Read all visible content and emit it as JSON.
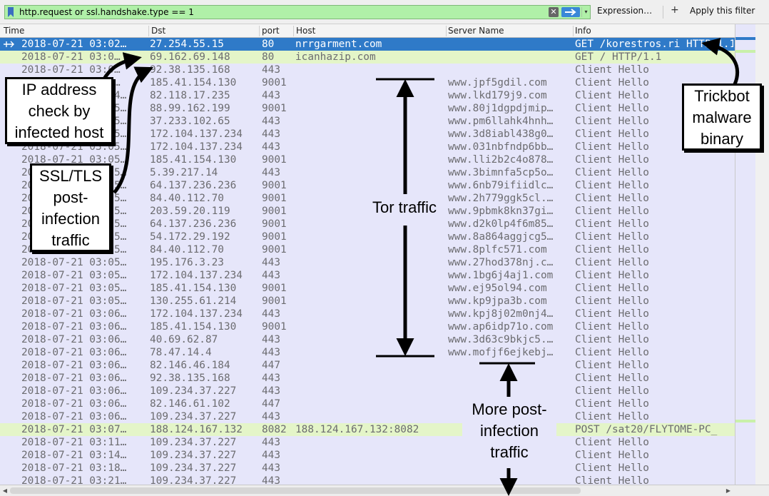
{
  "toolbar": {
    "filter_value": "http.request or ssl.handshake.type == 1",
    "clear_glyph": "✕",
    "dropdown_glyph": "▾",
    "expression_label": "Expression…",
    "add_glyph": "+",
    "apply_label": "Apply this filter",
    "filter_color": "#b0f0a8"
  },
  "columns": [
    "Time",
    "Dst",
    "port",
    "Host",
    "Server Name",
    "Info"
  ],
  "colors": {
    "selected_row": "#2f7ac8",
    "http_row": "#e4f5c8",
    "tls_row": "#e6e6fa"
  },
  "packets": [
    {
      "time": "2018-07-21 03:02…",
      "dst": "27.254.55.15",
      "port": "80",
      "host": "nrrgarment.com",
      "sni": "",
      "info": "GET /korestros.ri HTTP/1.1",
      "kind": "selected"
    },
    {
      "time": "2018-07-21 03:0…",
      "dst": "69.162.69.148",
      "port": "80",
      "host": "icanhazip.com",
      "sni": "",
      "info": "GET / HTTP/1.1",
      "kind": "http"
    },
    {
      "time": "2018-07-21 03:0…",
      "dst": "92.38.135.168",
      "port": "443",
      "host": "",
      "sni": "",
      "info": "Client Hello",
      "kind": "tls"
    },
    {
      "time": "2018-07-21 03:0…",
      "dst": "185.41.154.130",
      "port": "9001",
      "host": "",
      "sni": "www.jpf5gdil.com",
      "info": "Client Hello",
      "kind": "tls"
    },
    {
      "time": "2018-07-21 03:04…",
      "dst": "82.118.17.235",
      "port": "443",
      "host": "",
      "sni": "www.lkd179j9.com",
      "info": "Client Hello",
      "kind": "tls"
    },
    {
      "time": "2018-07-21 03:05…",
      "dst": "88.99.162.199",
      "port": "9001",
      "host": "",
      "sni": "www.80j1dgpdjmip…",
      "info": "Client Hello",
      "kind": "tls"
    },
    {
      "time": "2018-07-21 03:05…",
      "dst": "37.233.102.65",
      "port": "443",
      "host": "",
      "sni": "www.pm6llahk4hnh…",
      "info": "Client Hello",
      "kind": "tls"
    },
    {
      "time": "2018-07-21 03:05…",
      "dst": "172.104.137.234",
      "port": "443",
      "host": "",
      "sni": "www.3d8iabl438g0…",
      "info": "Client Hello",
      "kind": "tls"
    },
    {
      "time": "2018-07-21 03:05…",
      "dst": "172.104.137.234",
      "port": "443",
      "host": "",
      "sni": "www.031nbfndp6bb…",
      "info": "Client Hello",
      "kind": "tls"
    },
    {
      "time": "2018-07-21 03:05…",
      "dst": "185.41.154.130",
      "port": "9001",
      "host": "",
      "sni": "www.lli2b2c4o878…",
      "info": "Client Hello",
      "kind": "tls"
    },
    {
      "time": "2018-07-21 03:05…",
      "dst": "5.39.217.14",
      "port": "443",
      "host": "",
      "sni": "www.3bimnfa5cp5o…",
      "info": "Client Hello",
      "kind": "tls"
    },
    {
      "time": "2018-07-21 03:05…",
      "dst": "64.137.236.236",
      "port": "9001",
      "host": "",
      "sni": "www.6nb79ifiidlc…",
      "info": "Client Hello",
      "kind": "tls"
    },
    {
      "time": "2018-07-21 03:05…",
      "dst": "84.40.112.70",
      "port": "9001",
      "host": "",
      "sni": "www.2h779ggk5cl.…",
      "info": "Client Hello",
      "kind": "tls"
    },
    {
      "time": "2018-07-21 03:05…",
      "dst": "203.59.20.119",
      "port": "9001",
      "host": "",
      "sni": "www.9pbmk8kn37gi…",
      "info": "Client Hello",
      "kind": "tls"
    },
    {
      "time": "2018-07-21 03:05…",
      "dst": "64.137.236.236",
      "port": "9001",
      "host": "",
      "sni": "www.d2k0lp4f6m85…",
      "info": "Client Hello",
      "kind": "tls"
    },
    {
      "time": "2018-07-21 03:05…",
      "dst": "54.172.29.192",
      "port": "9001",
      "host": "",
      "sni": "www.8a864aggjcg5…",
      "info": "Client Hello",
      "kind": "tls"
    },
    {
      "time": "2018-07-21 03:05…",
      "dst": "84.40.112.70",
      "port": "9001",
      "host": "",
      "sni": "www.8plfc571.com",
      "info": "Client Hello",
      "kind": "tls"
    },
    {
      "time": "2018-07-21 03:05…",
      "dst": "195.176.3.23",
      "port": "443",
      "host": "",
      "sni": "www.27hod378nj.c…",
      "info": "Client Hello",
      "kind": "tls"
    },
    {
      "time": "2018-07-21 03:05…",
      "dst": "172.104.137.234",
      "port": "443",
      "host": "",
      "sni": "www.1bg6j4aj1.com",
      "info": "Client Hello",
      "kind": "tls"
    },
    {
      "time": "2018-07-21 03:05…",
      "dst": "185.41.154.130",
      "port": "9001",
      "host": "",
      "sni": "www.ej95ol94.com",
      "info": "Client Hello",
      "kind": "tls"
    },
    {
      "time": "2018-07-21 03:05…",
      "dst": "130.255.61.214",
      "port": "9001",
      "host": "",
      "sni": "www.kp9jpa3b.com",
      "info": "Client Hello",
      "kind": "tls"
    },
    {
      "time": "2018-07-21 03:06…",
      "dst": "172.104.137.234",
      "port": "443",
      "host": "",
      "sni": "www.kpj8j02m0nj4…",
      "info": "Client Hello",
      "kind": "tls"
    },
    {
      "time": "2018-07-21 03:06…",
      "dst": "185.41.154.130",
      "port": "9001",
      "host": "",
      "sni": "www.ap6idp71o.com",
      "info": "Client Hello",
      "kind": "tls"
    },
    {
      "time": "2018-07-21 03:06…",
      "dst": "40.69.62.87",
      "port": "443",
      "host": "",
      "sni": "www.3d63c9bkjc5.…",
      "info": "Client Hello",
      "kind": "tls"
    },
    {
      "time": "2018-07-21 03:06…",
      "dst": "78.47.14.4",
      "port": "443",
      "host": "",
      "sni": "www.mofjf6ejkebj…",
      "info": "Client Hello",
      "kind": "tls"
    },
    {
      "time": "2018-07-21 03:06…",
      "dst": "82.146.46.184",
      "port": "447",
      "host": "",
      "sni": "",
      "info": "Client Hello",
      "kind": "tls"
    },
    {
      "time": "2018-07-21 03:06…",
      "dst": "92.38.135.168",
      "port": "443",
      "host": "",
      "sni": "",
      "info": "Client Hello",
      "kind": "tls"
    },
    {
      "time": "2018-07-21 03:06…",
      "dst": "109.234.37.227",
      "port": "443",
      "host": "",
      "sni": "",
      "info": "Client Hello",
      "kind": "tls"
    },
    {
      "time": "2018-07-21 03:06…",
      "dst": "82.146.61.102",
      "port": "447",
      "host": "",
      "sni": "",
      "info": "Client Hello",
      "kind": "tls"
    },
    {
      "time": "2018-07-21 03:06…",
      "dst": "109.234.37.227",
      "port": "443",
      "host": "",
      "sni": "",
      "info": "Client Hello",
      "kind": "tls"
    },
    {
      "time": "2018-07-21 03:07…",
      "dst": "188.124.167.132",
      "port": "8082",
      "host": "188.124.167.132:8082",
      "sni": "",
      "info": "POST /sat20/FLYTOME-PC_",
      "kind": "http"
    },
    {
      "time": "2018-07-21 03:11…",
      "dst": "109.234.37.227",
      "port": "443",
      "host": "",
      "sni": "",
      "info": "Client Hello",
      "kind": "tls"
    },
    {
      "time": "2018-07-21 03:14…",
      "dst": "109.234.37.227",
      "port": "443",
      "host": "",
      "sni": "",
      "info": "Client Hello",
      "kind": "tls"
    },
    {
      "time": "2018-07-21 03:18…",
      "dst": "109.234.37.227",
      "port": "443",
      "host": "",
      "sni": "",
      "info": "Client Hello",
      "kind": "tls"
    },
    {
      "time": "2018-07-21 03:21…",
      "dst": "109.234.37.227",
      "port": "443",
      "host": "",
      "sni": "",
      "info": "Client Hello",
      "kind": "tls"
    }
  ],
  "annotations": {
    "ip_check": "IP address\ncheck by\ninfected host",
    "ssl_tls": "SSL/TLS\npost-\ninfection\ntraffic",
    "trickbot": "Trickbot\nmalware\nbinary",
    "tor": "Tor traffic",
    "more_post": "More post-\ninfection\ntraffic"
  }
}
